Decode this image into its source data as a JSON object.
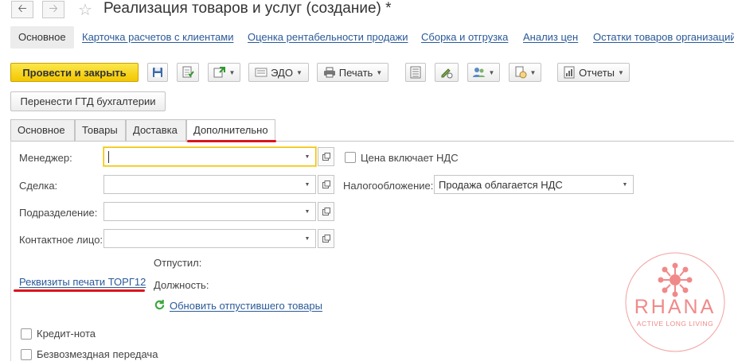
{
  "window": {
    "title": "Реализация товаров и услуг (создание) *",
    "back_icon": "arrow-left-icon",
    "forward_icon": "arrow-right-icon",
    "favorite_icon": "star-icon"
  },
  "sections": {
    "active": "Основное",
    "links": [
      "Карточка расчетов с клиентами",
      "Оценка рентабельности продажи",
      "Сборка и отгрузка",
      "Анализ цен",
      "Остатки товаров организаций"
    ]
  },
  "toolbar": {
    "post_close": "Провести и закрыть",
    "edo": "ЭДО",
    "print": "Печать",
    "reports": "Отчеты"
  },
  "gtd_button": "Перенести ГТД бухгалтерии",
  "form_tabs": [
    "Основное",
    "Товары",
    "Доставка",
    "Дополнительно"
  ],
  "fields": {
    "manager": {
      "label": "Менеджер:",
      "value": ""
    },
    "deal": {
      "label": "Сделка:",
      "value": ""
    },
    "division": {
      "label": "Подразделение:",
      "value": ""
    },
    "contact": {
      "label": "Контактное лицо:",
      "value": ""
    }
  },
  "price_includes_vat": {
    "label": "Цена включает НДС",
    "checked": false
  },
  "taxation": {
    "label": "Налогообложение:",
    "value": "Продажа облагается НДС"
  },
  "released_by_label": "Отпустил:",
  "position_label": "Должность:",
  "torg12_link": "Реквизиты печати ТОРГ12",
  "update_link": "Обновить отпустившего товары",
  "credit_note": {
    "label": "Кредит-нота",
    "checked": false
  },
  "free_transfer": {
    "label": "Безвозмездная передача",
    "checked": false
  },
  "watermark": {
    "brand": "RHANA",
    "tagline": "ACTIVE LONG LIVING",
    "color": "#f08a8a"
  },
  "colors": {
    "primary_button": "#f5d220",
    "link": "#2a5a99",
    "annotation_red": "#d9161c",
    "focus": "#f2c200"
  }
}
